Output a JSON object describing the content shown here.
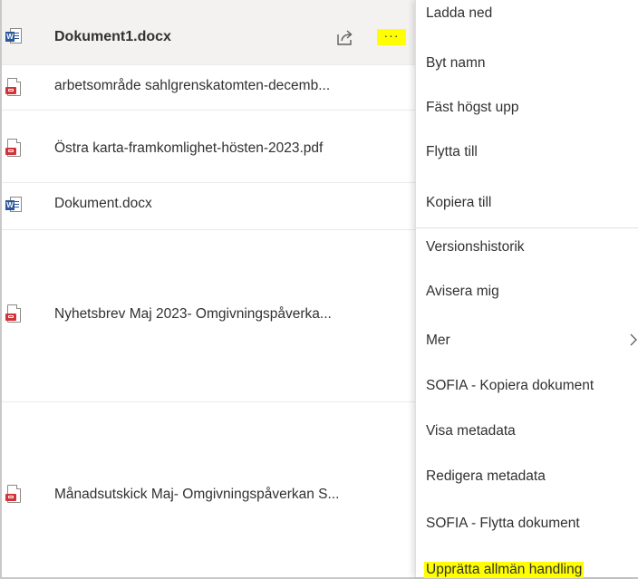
{
  "files": [
    {
      "name": "Dokument1.docx",
      "type": "word",
      "selected": true
    },
    {
      "name": "arbetsområde sahlgrenskatomten-decemb...",
      "type": "pdf"
    },
    {
      "name": "Östra karta-framkomlighet-hösten-2023.pdf",
      "type": "pdf"
    },
    {
      "name": "Dokument.docx",
      "type": "word"
    },
    {
      "name": "Nyhetsbrev Maj 2023- Omgivningspåverka...",
      "type": "pdf"
    },
    {
      "name": "Månadsutskick Maj- Omgivningspåverkan S...",
      "type": "pdf"
    }
  ],
  "row_actions": {
    "share_icon": "share-icon",
    "more_label": "···"
  },
  "menu": {
    "items": [
      "Ladda ned",
      "Byt namn",
      "Fäst högst upp",
      "Flytta till",
      "Kopiera till",
      "Versionshistorik",
      "Avisera mig",
      "Mer",
      "SOFIA - Kopiera dokument",
      "Visa metadata",
      "Redigera metadata",
      "SOFIA - Flytta dokument",
      "Upprätta allmän handling"
    ]
  },
  "colors": {
    "highlight": "#ffff00",
    "word_blue": "#2b579a",
    "pdf_red": "#d13438",
    "selected_row": "#f3f2f1",
    "text": "#323130"
  }
}
